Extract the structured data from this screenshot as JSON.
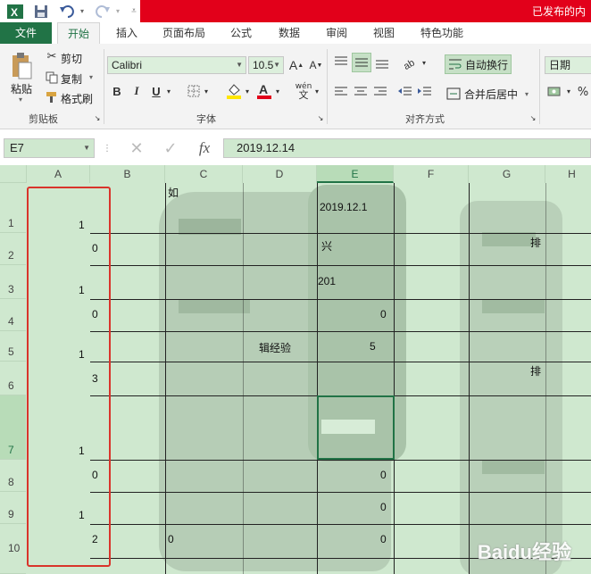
{
  "titlebar": {
    "app_icon": "X",
    "right_text": "已发布的内"
  },
  "tabs": [
    "文件",
    "开始",
    "插入",
    "页面布局",
    "公式",
    "数据",
    "审阅",
    "视图",
    "特色功能"
  ],
  "ribbon": {
    "clipboard": {
      "paste": "粘贴",
      "cut": "剪切",
      "copy": "复制",
      "format_painter": "格式刷",
      "group": "剪贴板"
    },
    "font": {
      "name": "Calibri",
      "size": "10.5",
      "bold": "B",
      "italic": "I",
      "underline": "U",
      "group": "字体",
      "phonetic": "wén"
    },
    "alignment": {
      "wrap": "自动换行",
      "merge": "合并后居中",
      "group": "对齐方式"
    },
    "number": {
      "format": "日期"
    }
  },
  "formula_bar": {
    "name_box": "E7",
    "formula": "2019.12.14"
  },
  "sheet": {
    "columns": [
      "A",
      "B",
      "C",
      "D",
      "E",
      "F",
      "G",
      "H"
    ],
    "rows": [
      "1",
      "2",
      "3",
      "4",
      "5",
      "6",
      "7",
      "8",
      "9",
      "10"
    ],
    "selected_col": "E",
    "selected_row": "7",
    "col_a_values": [
      "1",
      "1",
      "1",
      "1",
      "1"
    ],
    "col_b_values": [
      "0",
      "0",
      "3",
      "0",
      "2"
    ],
    "e1_value": "2019.12.1",
    "e3_value": "201",
    "d5_fragment": "辑经验",
    "e5_fragment": "5",
    "c_top_fragment": "如",
    "e2_fragment": "兴",
    "g2_fragment": "排",
    "g6_fragment": "排",
    "c10_fragment": "0",
    "zero_values": [
      "0",
      "0",
      "0",
      "0"
    ]
  },
  "watermark": "Baidu经验"
}
